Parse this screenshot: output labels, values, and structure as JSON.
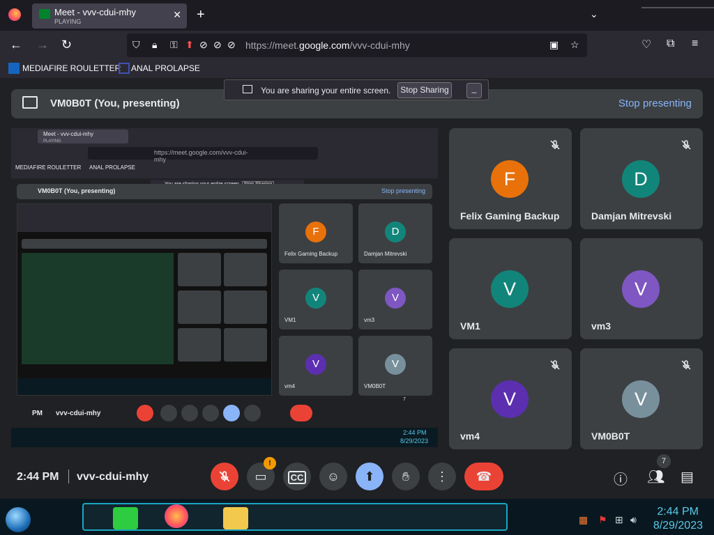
{
  "browser": {
    "tab": {
      "title": "Meet - vvv-cdui-mhy",
      "status": "PLAYING"
    },
    "url": {
      "prefix": "https://meet.",
      "domain": "google.com",
      "path": "/vvv-cdui-mhy"
    },
    "bookmarks": [
      {
        "label": "MEDIAFIRE ROULETTER"
      },
      {
        "label": "ANAL PROLAPSE"
      }
    ]
  },
  "share_bar": {
    "text": "You are sharing your entire screen.",
    "stop_label": "Stop Sharing",
    "minimize_label": "_"
  },
  "banner": {
    "title": "VM0B0T (You, presenting)",
    "stop_label": "Stop presenting"
  },
  "preview": {
    "tab_title": "Meet - vvv-cdui-mhy",
    "tab_status": "PLAYING",
    "url": "https://meet.google.com/vvv-cdui-mhy",
    "banner_title": "VM0B0T (You, presenting)",
    "banner_stop": "Stop presenting",
    "share_text": "You are sharing your entire screen.",
    "share_stop": "Stop Sharing",
    "bookmark1": "MEDIAFIRE ROULETTER",
    "bookmark2": "ANAL PROLAPSE",
    "time": "PM",
    "code": "vvv-cdui-mhy",
    "taskbar_time": "2:44 PM",
    "taskbar_date": "8/29/2023",
    "participants_count": "7",
    "tiles": [
      {
        "initial": "F",
        "name": "Felix Gaming Backup",
        "color": "#e8710a"
      },
      {
        "initial": "D",
        "name": "Damjan Mitrevski",
        "color": "#12857a"
      },
      {
        "initial": "V",
        "name": "VM1",
        "color": "#12857a"
      },
      {
        "initial": "V",
        "name": "vm3",
        "color": "#7e57c2"
      },
      {
        "initial": "V",
        "name": "vm4",
        "color": "#5b2fb0"
      },
      {
        "initial": "V",
        "name": "VM0B0T",
        "color": "#78909c"
      }
    ]
  },
  "participants": [
    {
      "initial": "F",
      "name": "Felix Gaming Backup",
      "color": "#e8710a"
    },
    {
      "initial": "D",
      "name": "Damjan Mitrevski",
      "color": "#12857a"
    },
    {
      "initial": "V",
      "name": "VM1",
      "color": "#12857a"
    },
    {
      "initial": "V",
      "name": "vm3",
      "color": "#7e57c2"
    },
    {
      "initial": "V",
      "name": "vm4",
      "color": "#5b2fb0"
    },
    {
      "initial": "V",
      "name": "VM0B0T",
      "color": "#78909c"
    }
  ],
  "controls": {
    "time": "2:44 PM",
    "meeting_code": "vvv-cdui-mhy",
    "camera_badge": "!",
    "participants_count": "7"
  },
  "taskbar": {
    "time": "2:44 PM",
    "date": "8/29/2023"
  }
}
